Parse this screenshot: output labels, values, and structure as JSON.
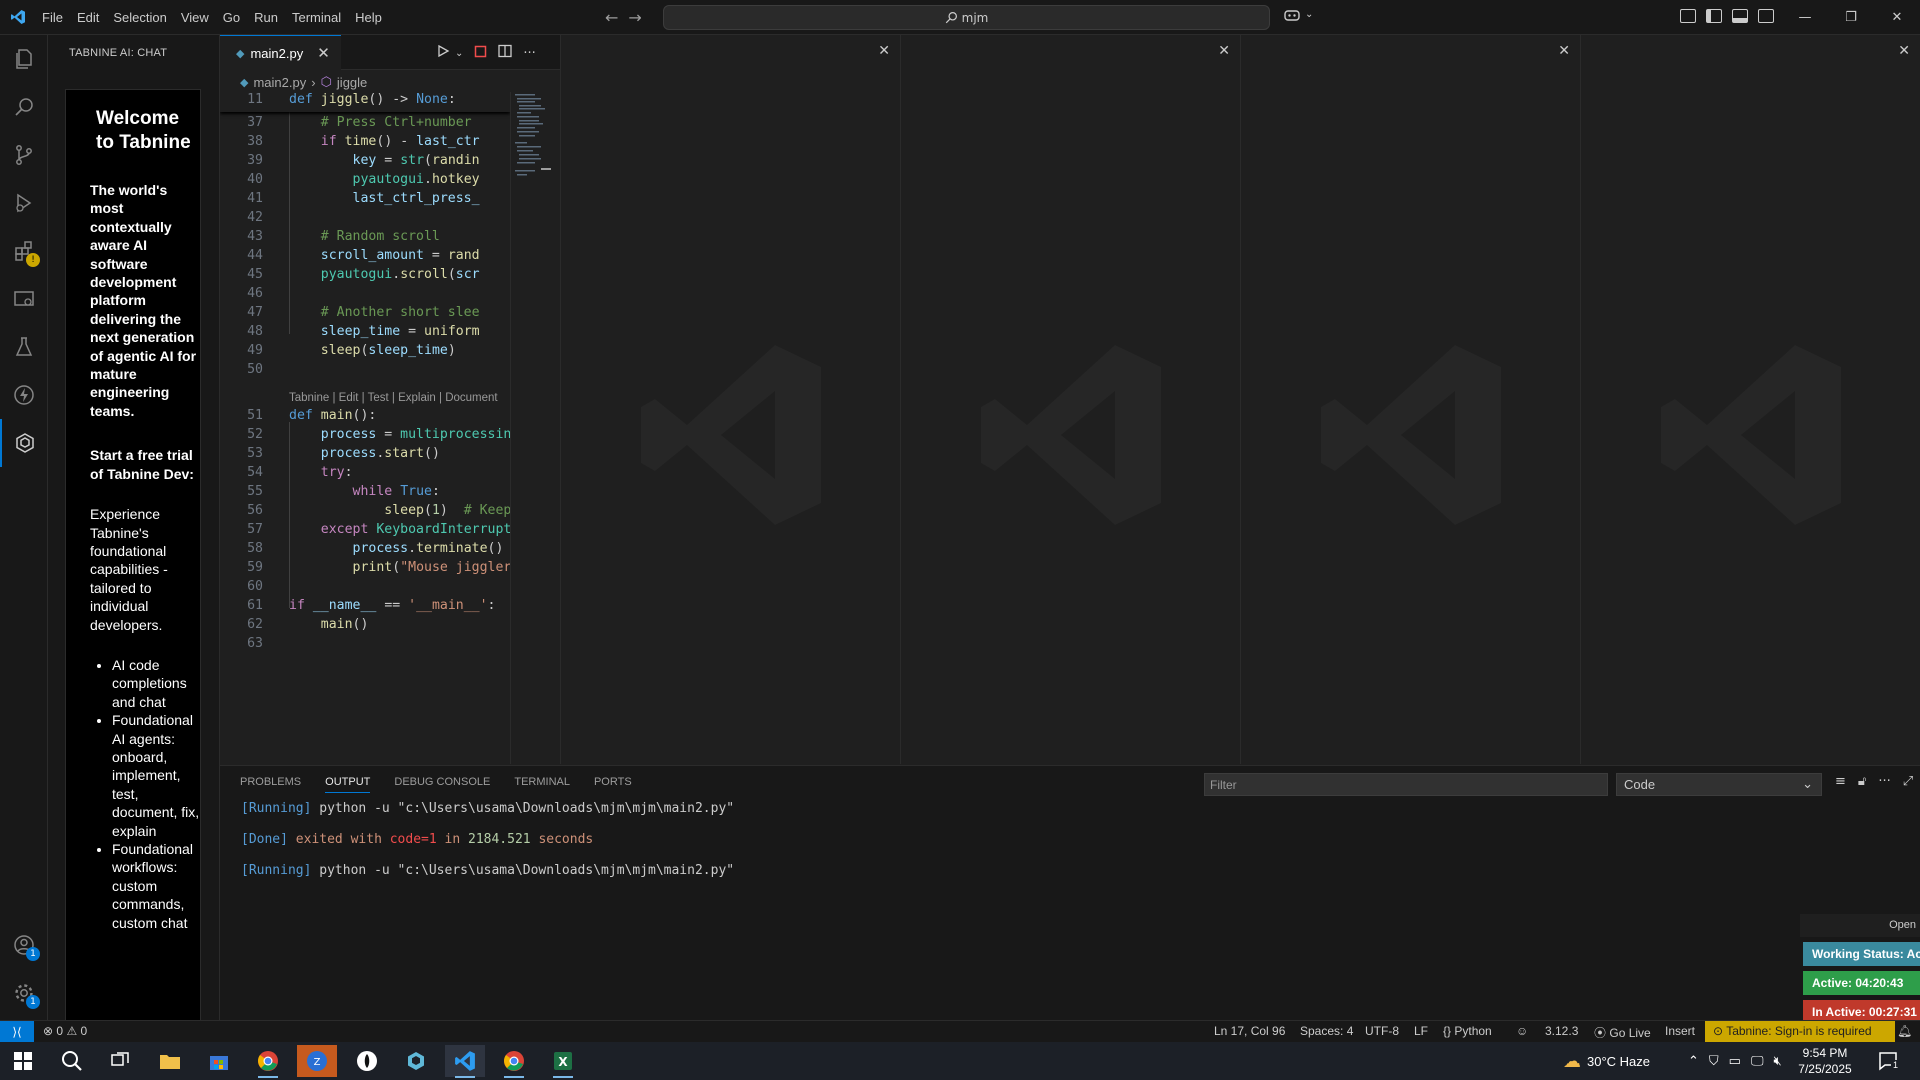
{
  "titlebar": {
    "menu": [
      "File",
      "Edit",
      "Selection",
      "View",
      "Go",
      "Run",
      "Terminal",
      "Help"
    ],
    "search_text": "mjm",
    "nav_back": "←",
    "nav_forward": "→"
  },
  "sidebar": {
    "header": "TABNINE AI: CHAT",
    "welcome_title": "Welcome to Tabnine",
    "tagline": "The world's most contextually aware AI software development platform delivering the next generation of agentic AI for mature engineering teams.",
    "trial_heading": "Start a free trial of Tabnine Dev:",
    "trial_text": "Experience Tabnine's foundational capabilities - tailored to individual developers.",
    "features": [
      "AI code completions and chat",
      "Foundational AI agents: onboard, implement, test, document, fix, explain",
      "Foundational workflows: custom commands, custom chat"
    ]
  },
  "activitybar": {
    "accounts_badge": "1",
    "settings_badge": "1"
  },
  "editor": {
    "tab_label": "main2.py",
    "breadcrumb_file": "main2.py",
    "breadcrumb_symbol": "jiggle",
    "codelens": "Tabnine | Edit | Test | Explain | Document"
  },
  "panel": {
    "tabs": [
      "PROBLEMS",
      "OUTPUT",
      "DEBUG CONSOLE",
      "TERMINAL",
      "PORTS"
    ],
    "active_tab": "OUTPUT",
    "filter_placeholder": "Filter",
    "channel": "Code",
    "output": [
      {
        "tag": "[Running]",
        "text": "python -u \"c:\\Users\\usama\\Downloads\\mjm\\mjm\\main2.py\""
      },
      {
        "tag": "[Done]",
        "text_pre": "exited with ",
        "code": "code=1",
        "text_mid": " in ",
        "seconds": "2184.521",
        "text_post": " seconds"
      },
      {
        "tag": "[Running]",
        "text": "python -u \"c:\\Users\\usama\\Downloads\\mjm\\mjm\\main2.py\""
      }
    ]
  },
  "working_status": {
    "open_label": "Open",
    "status": "Working Status: Ac",
    "active": "Active: 04:20:43",
    "inactive": "In Active: 00:27:31",
    "colors": {
      "status": "#3a8a9e",
      "active": "#2e9e4a",
      "inactive": "#c0392b"
    }
  },
  "statusbar": {
    "errors": "0",
    "warnings": "0",
    "position": "Ln 17, Col 96",
    "spaces": "Spaces: 4",
    "encoding": "UTF-8",
    "eol": "LF",
    "language": "Python",
    "interpreter": "3.12.3",
    "golive": "Go Live",
    "mode": "Insert",
    "tabnine": "Tabnine: Sign-in is required"
  },
  "taskbar": {
    "weather": "30°C  Haze",
    "time": "9:54 PM",
    "date": "7/25/2025",
    "notification_count": "1"
  },
  "colors": {
    "accent": "#0078d4",
    "warning": "#cca700"
  }
}
